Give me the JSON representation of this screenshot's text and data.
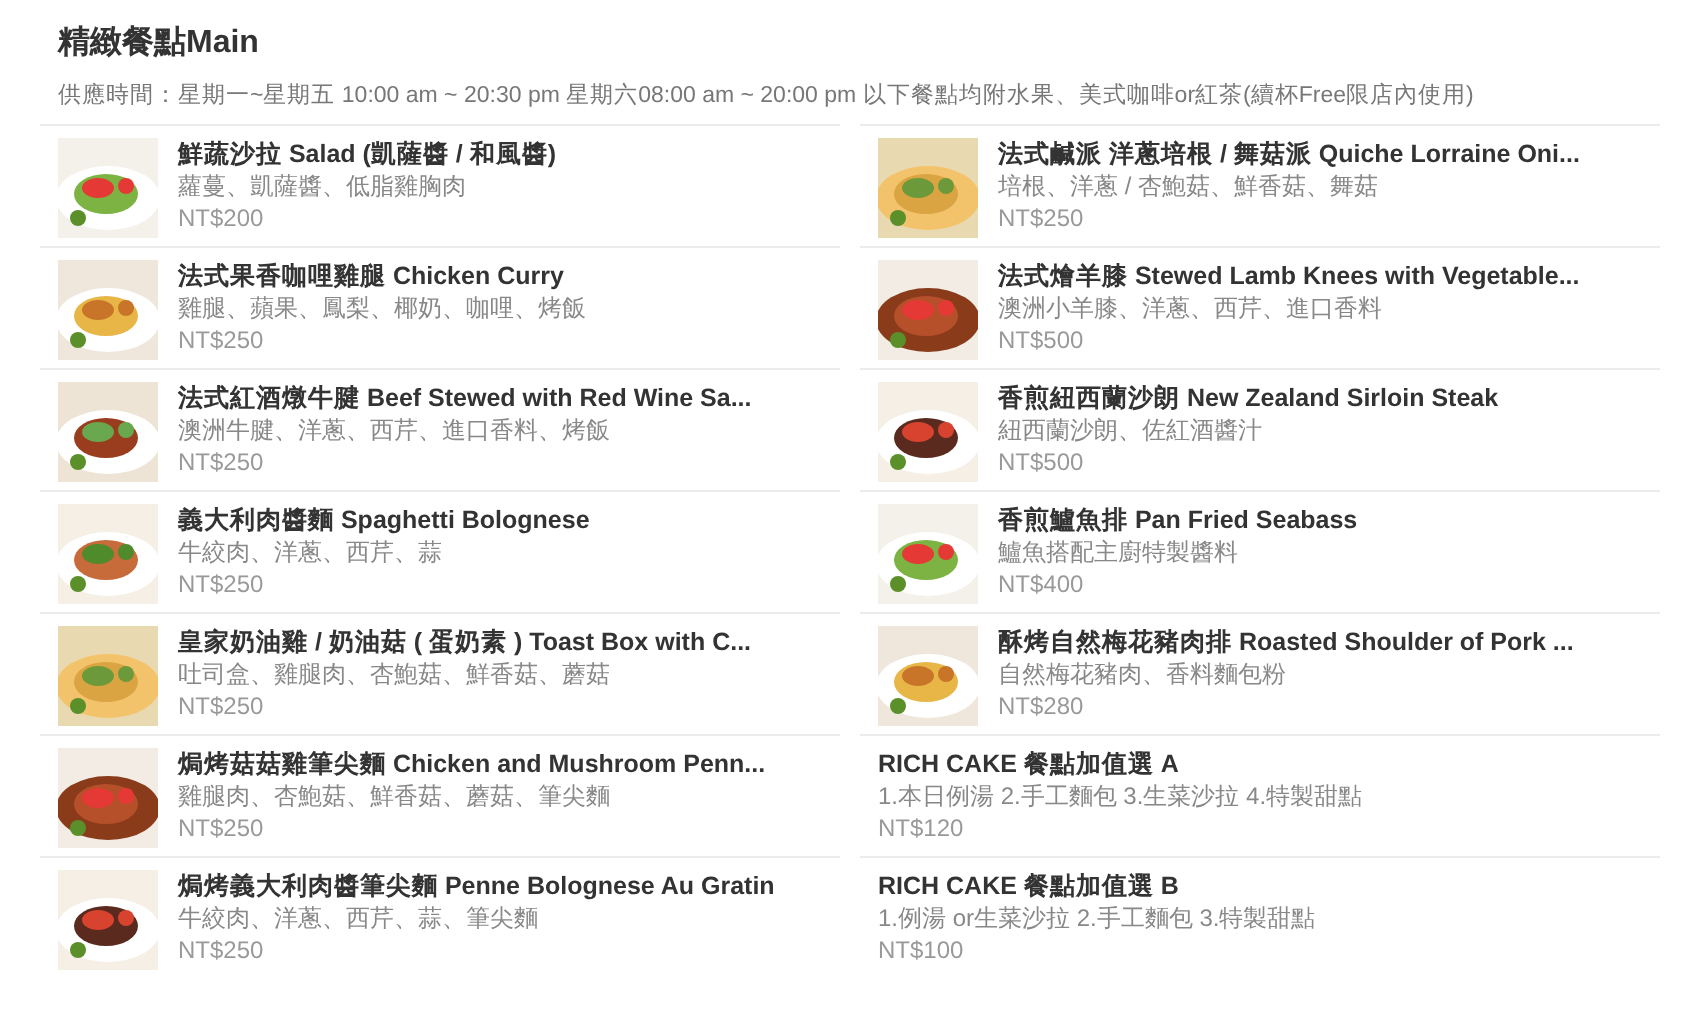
{
  "title": "精緻餐點Main",
  "subtitle": "供應時間：星期一~星期五 10:00 am ~ 20:30 pm 星期六08:00 am ~ 20:00 pm 以下餐點均附水果、美式咖啡or紅茶(續杯Free限店內使用)",
  "items": [
    {
      "name": "鮮蔬沙拉 Salad (凱薩醬 / 和風醬)",
      "description": "蘿蔓、凱薩醬、低脂雞胸肉",
      "price": "NT$200"
    },
    {
      "name": "法式鹹派 洋蔥培根 / 舞菇派 Quiche Lorraine Oni...",
      "description": "培根、洋蔥 / 杏鮑菇、鮮香菇、舞菇",
      "price": "NT$250"
    },
    {
      "name": "法式果香咖哩雞腿 Chicken Curry",
      "description": "雞腿、蘋果、鳳梨、椰奶、咖哩、烤飯",
      "price": "NT$250"
    },
    {
      "name": "法式燴羊膝 Stewed Lamb Knees with Vegetable...",
      "description": "澳洲小羊膝、洋蔥、西芹、進口香料",
      "price": "NT$500"
    },
    {
      "name": "法式紅酒燉牛腱 Beef Stewed with Red Wine Sa...",
      "description": "澳洲牛腱、洋蔥、西芹、進口香料、烤飯",
      "price": "NT$250"
    },
    {
      "name": "香煎紐西蘭沙朗 New Zealand Sirloin Steak",
      "description": "紐西蘭沙朗、佐紅酒醬汁",
      "price": "NT$500"
    },
    {
      "name": "義大利肉醬麵 Spaghetti Bolognese",
      "description": "牛絞肉、洋蔥、西芹、蒜",
      "price": "NT$250"
    },
    {
      "name": "香煎鱸魚排 Pan Fried Seabass",
      "description": "鱸魚搭配主廚特製醬料",
      "price": "NT$400"
    },
    {
      "name": "皇家奶油雞 / 奶油菇 ( 蛋奶素 ) Toast Box with C...",
      "description": "吐司盒、雞腿肉、杏鮑菇、鮮香菇、蘑菇",
      "price": "NT$250"
    },
    {
      "name": "酥烤自然梅花豬肉排 Roasted Shoulder of Pork ...",
      "description": "自然梅花豬肉、香料麵包粉",
      "price": "NT$280"
    },
    {
      "name": "焗烤菇菇雞筆尖麵 Chicken and Mushroom Penn...",
      "description": "雞腿肉、杏鮑菇、鮮香菇、蘑菇、筆尖麵",
      "price": "NT$250"
    },
    {
      "name": "RICH CAKE 餐點加值選 A",
      "description": "1.本日例湯 2.手工麵包 3.生菜沙拉 4.特製甜點",
      "price": "NT$120"
    },
    {
      "name": "焗烤義大利肉醬筆尖麵 Penne Bolognese Au Gratin",
      "description": "牛絞肉、洋蔥、西芹、蒜、筆尖麵",
      "price": "NT$250"
    },
    {
      "name": "RICH CAKE 餐點加值選 B",
      "description": "1.例湯 or生菜沙拉 2.手工麵包 3.特製甜點",
      "price": "NT$100"
    }
  ]
}
